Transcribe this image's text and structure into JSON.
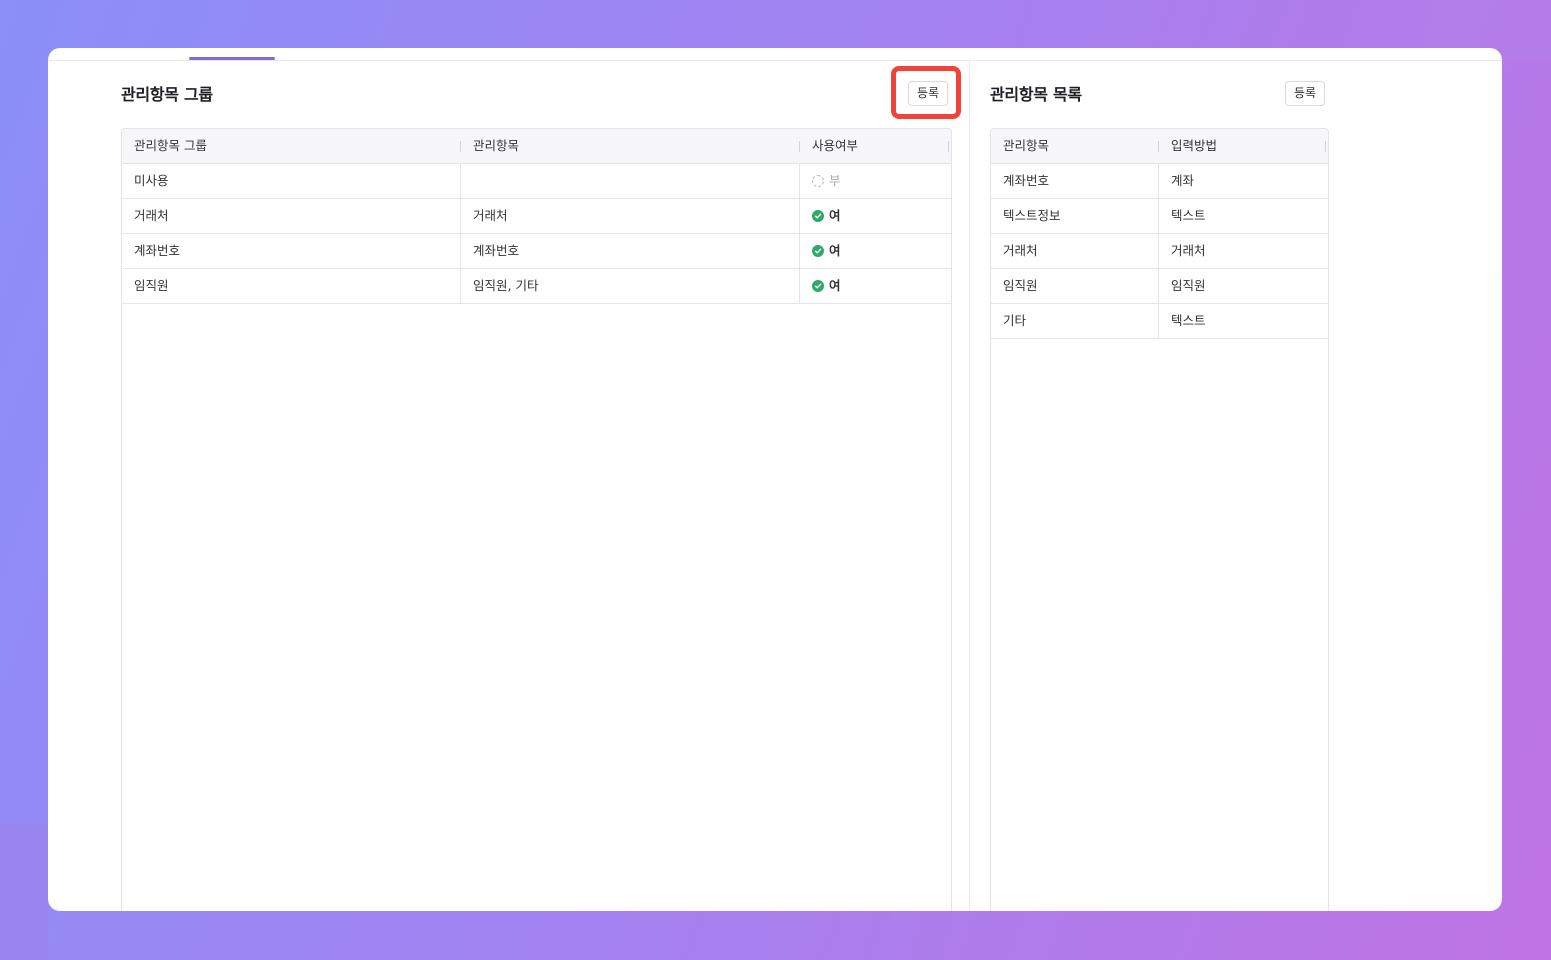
{
  "left_panel": {
    "title": "관리항목 그룹",
    "register_button": "등록",
    "columns": [
      "관리항목 그룹",
      "관리항목",
      "사용여부"
    ],
    "rows": [
      {
        "group": "미사용",
        "items": "",
        "usage": "부",
        "usage_active": false
      },
      {
        "group": "거래처",
        "items": "거래처",
        "usage": "여",
        "usage_active": true
      },
      {
        "group": "계좌번호",
        "items": "계좌번호",
        "usage": "여",
        "usage_active": true
      },
      {
        "group": "임직원",
        "items": "임직원, 기타",
        "usage": "여",
        "usage_active": true
      }
    ]
  },
  "right_panel": {
    "title": "관리항목 목록",
    "register_button": "등록",
    "columns": [
      "관리항목",
      "입력방법"
    ],
    "rows": [
      {
        "item": "계좌번호",
        "method": "계좌"
      },
      {
        "item": "텍스트정보",
        "method": "텍스트"
      },
      {
        "item": "거래처",
        "method": "거래처"
      },
      {
        "item": "임직원",
        "method": "임직원"
      },
      {
        "item": "기타",
        "method": "텍스트"
      }
    ]
  },
  "colors": {
    "accent": "#7b6fd6",
    "highlight": "#f0443a",
    "status_on": "#2fa86a",
    "status_off": "#a9a9b2"
  },
  "icons": {
    "active": "check-circle-icon",
    "inactive": "dotted-circle-icon"
  }
}
